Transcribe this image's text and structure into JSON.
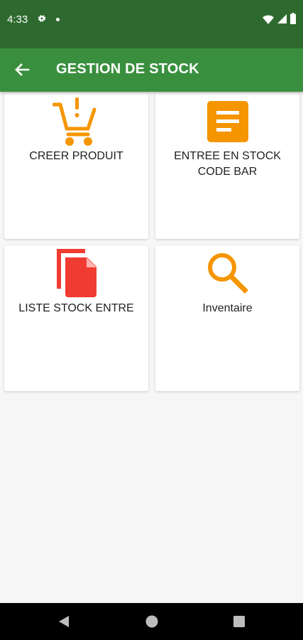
{
  "status_bar": {
    "time": "4:33"
  },
  "app_bar": {
    "title": "GESTION DE STOCK"
  },
  "tiles": [
    {
      "label_lines": [
        "CREER PRODUIT"
      ],
      "icon": "cart-alert-icon",
      "color": "#f59500"
    },
    {
      "label_lines": [
        "ENTREE EN STOCK",
        "CODE BAR"
      ],
      "icon": "document-lines-icon",
      "color": "#f59500"
    },
    {
      "label_lines": [
        "LISTE STOCK ENTRE"
      ],
      "icon": "copy-file-icon",
      "color": "#f03b32"
    },
    {
      "label_lines": [
        "Inventaire"
      ],
      "icon": "search-icon",
      "color": "#f59500"
    }
  ],
  "colors": {
    "status_bar": "#2e6a2f",
    "app_bar": "#3a8f3e",
    "background": "#f6f6f6",
    "accent_orange": "#f59500",
    "accent_red": "#f03b32"
  }
}
